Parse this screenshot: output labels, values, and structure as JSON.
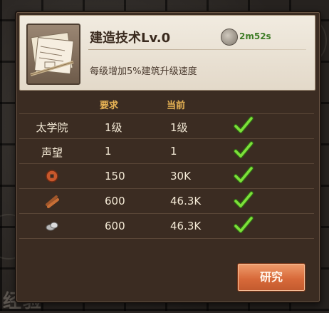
{
  "background": {
    "label": "经验"
  },
  "tech": {
    "title": "建造技术Lv.0",
    "time": "2m52s",
    "description": "每级增加5%建筑升级速度",
    "icon": "blueprint-scroll-icon"
  },
  "table": {
    "headers": {
      "required": "要求",
      "current": "当前"
    },
    "rows": [
      {
        "label": "太学院",
        "icon": "",
        "required": "1级",
        "current": "1级",
        "met": true
      },
      {
        "label": "声望",
        "icon": "",
        "required": "1",
        "current": "1",
        "met": true
      },
      {
        "label": "",
        "icon": "coin-icon",
        "required": "150",
        "current": "30K",
        "met": true
      },
      {
        "label": "",
        "icon": "wood-icon",
        "required": "600",
        "current": "46.3K",
        "met": true
      },
      {
        "label": "",
        "icon": "stone-icon",
        "required": "600",
        "current": "46.3K",
        "met": true
      }
    ]
  },
  "research_button": "研究",
  "colors": {
    "header_text": "#e8b455",
    "timer": "#3f7d27",
    "check": "#6fd12e",
    "button": "#d86a3a"
  }
}
